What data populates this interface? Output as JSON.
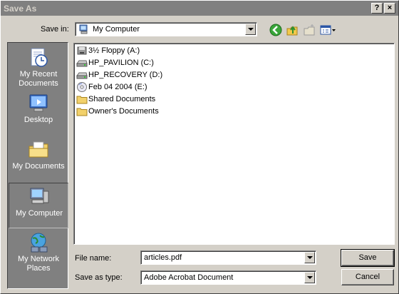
{
  "window": {
    "title": "Save As",
    "help_label": "?",
    "close_label": "×"
  },
  "toolbar": {
    "save_in_label": "Save in:",
    "save_in_value": "My Computer",
    "back_icon": "back-arrow-icon",
    "up_icon": "up-one-level-icon",
    "new_folder_icon": "new-folder-icon",
    "views_icon": "views-menu-icon"
  },
  "places": [
    {
      "label": "My Recent Documents",
      "icon": "recent-documents-icon"
    },
    {
      "label": "Desktop",
      "icon": "desktop-icon"
    },
    {
      "label": "My Documents",
      "icon": "my-documents-icon"
    },
    {
      "label": "My Computer",
      "icon": "my-computer-icon",
      "selected": true
    },
    {
      "label": "My Network Places",
      "icon": "network-places-icon"
    }
  ],
  "files": [
    {
      "name": "3½ Floppy (A:)",
      "icon": "floppy-drive-icon"
    },
    {
      "name": "HP_PAVILION (C:)",
      "icon": "hard-drive-icon"
    },
    {
      "name": "HP_RECOVERY (D:)",
      "icon": "hard-drive-icon"
    },
    {
      "name": "Feb 04 2004 (E:)",
      "icon": "cd-drive-icon"
    },
    {
      "name": "Shared Documents",
      "icon": "folder-icon"
    },
    {
      "name": "Owner's Documents",
      "icon": "folder-icon"
    }
  ],
  "form": {
    "file_name_label": "File name:",
    "file_name_value": "articles.pdf",
    "save_type_label": "Save as type:",
    "save_type_value": "Adobe Acrobat Document",
    "save_button": "Save",
    "cancel_button": "Cancel"
  }
}
